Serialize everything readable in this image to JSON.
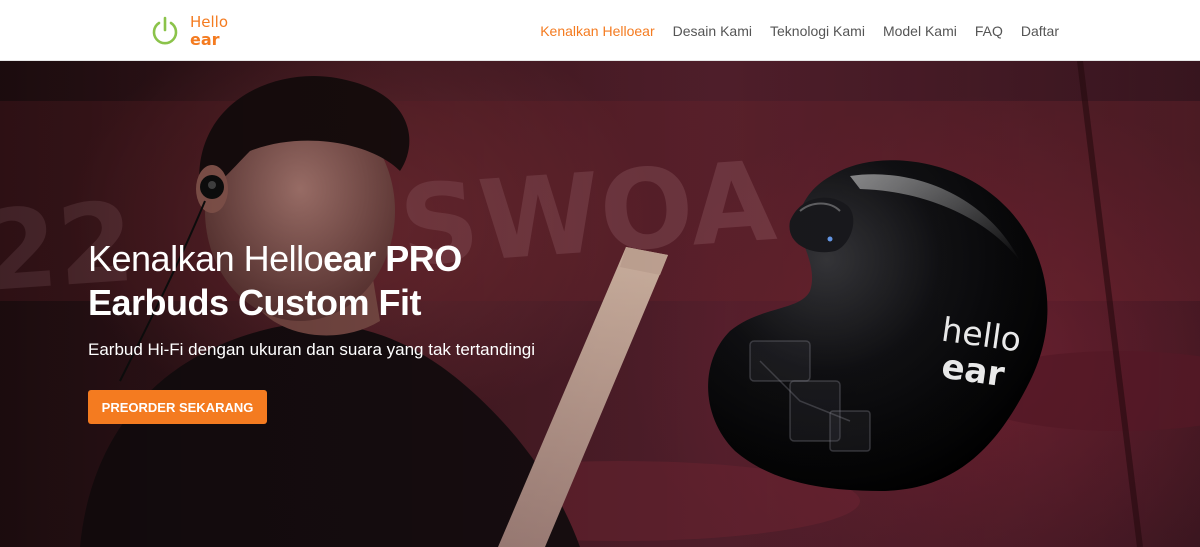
{
  "brand": {
    "line1": "Hello",
    "line2": "ear",
    "accent_color": "#f47b20",
    "power_icon_color": "#8bc34a"
  },
  "nav": {
    "items": [
      {
        "label": "Kenalkan Helloear",
        "active": true
      },
      {
        "label": "Desain Kami",
        "active": false
      },
      {
        "label": "Teknologi Kami",
        "active": false
      },
      {
        "label": "Model Kami",
        "active": false
      },
      {
        "label": "FAQ",
        "active": false
      },
      {
        "label": "Daftar",
        "active": false
      }
    ]
  },
  "hero": {
    "title_part1": "Kenalkan Hello",
    "title_part2": "ear PRO",
    "title_line2": "Earbuds Custom Fit",
    "subtitle": "Earbud Hi-Fi dengan ukuran dan suara yang tak tertandingi",
    "cta_label": "PREORDER SEKARANG",
    "product_logo_line1": "hello",
    "product_logo_line2": "ear"
  }
}
